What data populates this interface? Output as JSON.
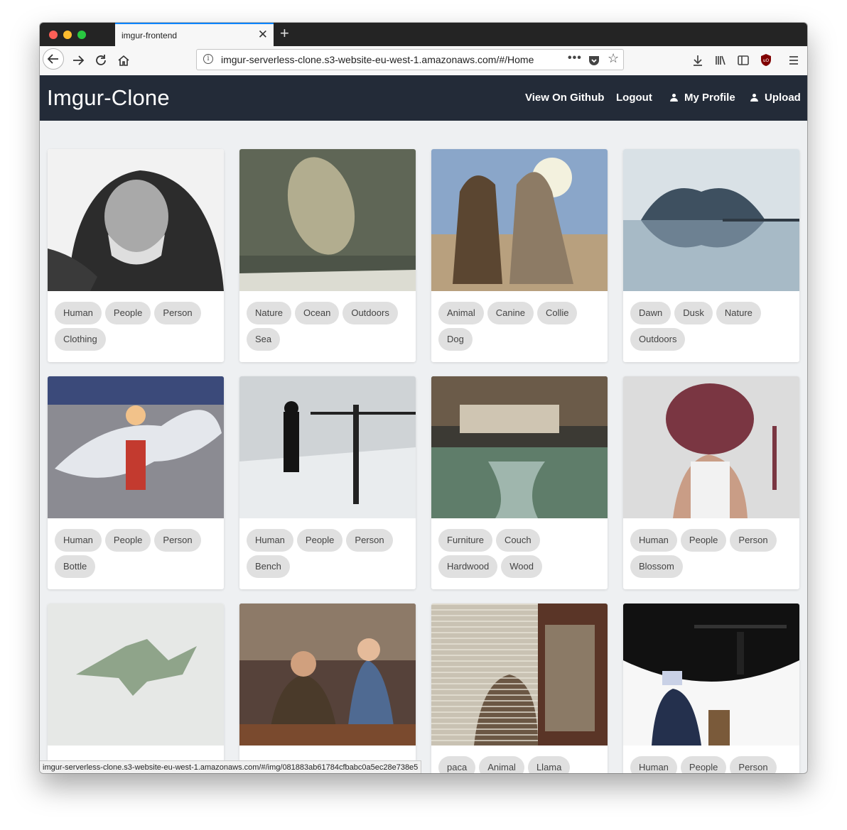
{
  "browser": {
    "tab_title": "imgur-frontend",
    "url": "imgur-serverless-clone.s3-website-eu-west-1.amazonaws.com/#/Home",
    "status_url": "imgur-serverless-clone.s3-website-eu-west-1.amazonaws.com/#/img/081883ab61784cfbabc0a5ec28e738e5"
  },
  "app": {
    "brand": "Imgur-Clone",
    "nav": {
      "github": "View On Github",
      "logout": "Logout",
      "profile": "My Profile",
      "upload": "Upload"
    }
  },
  "cards": [
    {
      "image": "man-in-hood",
      "tags": [
        "Human",
        "People",
        "Person",
        "Clothing"
      ]
    },
    {
      "image": "manatee-in-water",
      "tags": [
        "Nature",
        "Ocean",
        "Outdoors",
        "Sea"
      ]
    },
    {
      "image": "dogs-on-beach",
      "tags": [
        "Animal",
        "Canine",
        "Collie",
        "Dog"
      ]
    },
    {
      "image": "foggy-island",
      "tags": [
        "Dawn",
        "Dusk",
        "Nature",
        "Outdoors"
      ]
    },
    {
      "image": "girl-with-bottle-dragon",
      "tags": [
        "Human",
        "People",
        "Person",
        "Bottle"
      ]
    },
    {
      "image": "man-in-snow",
      "tags": [
        "Human",
        "People",
        "Person",
        "Bench"
      ]
    },
    {
      "image": "bedroom-cliff",
      "tags": [
        "Furniture",
        "Couch",
        "Hardwood",
        "Wood"
      ]
    },
    {
      "image": "flower-head-drawing",
      "tags": [
        "Human",
        "People",
        "Person",
        "Blossom"
      ]
    },
    {
      "image": "origami-shark",
      "tags": []
    },
    {
      "image": "people-at-cafe",
      "tags": []
    },
    {
      "image": "llama-at-door",
      "tags": [
        "paca",
        "Animal",
        "Llama"
      ]
    },
    {
      "image": "uncle-sam-cartoon",
      "tags": [
        "Human",
        "People",
        "Person"
      ]
    }
  ],
  "colors": {
    "appbar": "#232b38",
    "page_bg": "#eef0f2",
    "chip_bg": "#e0e0e0",
    "accent": "#0a84ff"
  }
}
